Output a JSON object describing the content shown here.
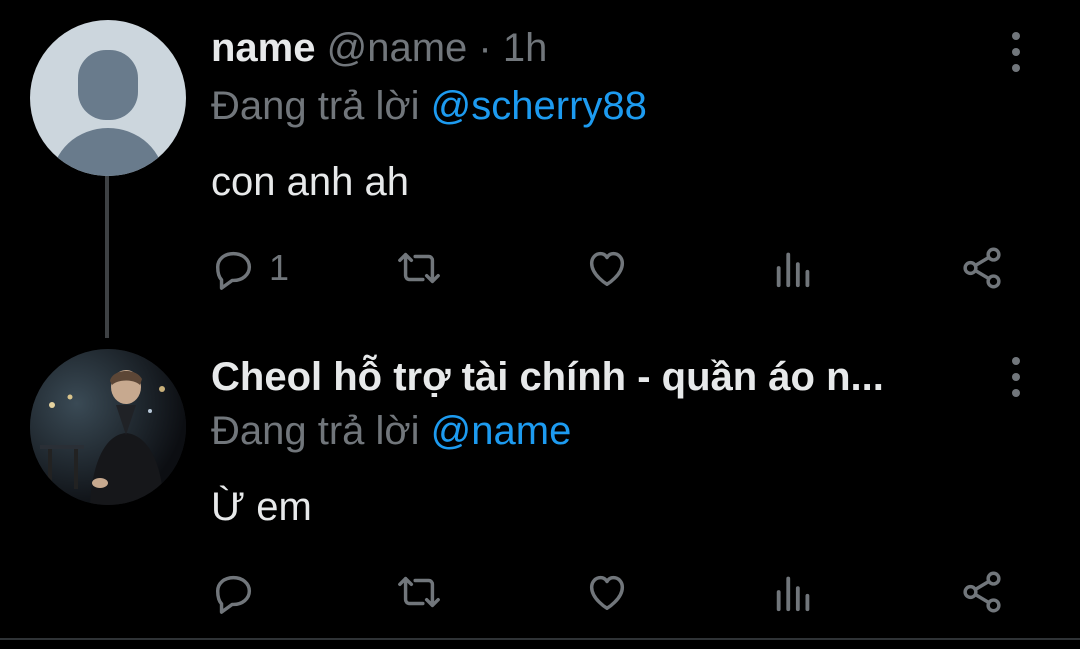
{
  "tweets": [
    {
      "name": "name",
      "handle": "@name",
      "separator": "·",
      "time": "1h",
      "replying_prefix": "Đang trả lời",
      "replying_to": "@scherry88",
      "text": "con anh ah",
      "reply_count": "1"
    },
    {
      "name": "Cheol hỗ trợ tài chính - quần áo n...",
      "replying_prefix": "Đang trả lời",
      "replying_to": "@name",
      "text": "Ừ em",
      "reply_count": ""
    }
  ],
  "icons": [
    "more-vertical-icon",
    "reply-icon",
    "retweet-icon",
    "like-icon",
    "analytics-icon",
    "share-icon"
  ],
  "colors": {
    "background": "#000000",
    "text": "#e7e9ea",
    "muted": "#71767b",
    "accent": "#1d9bf0",
    "default_avatar_bg": "#ccd6dd",
    "default_avatar_fg": "#697b8c"
  }
}
